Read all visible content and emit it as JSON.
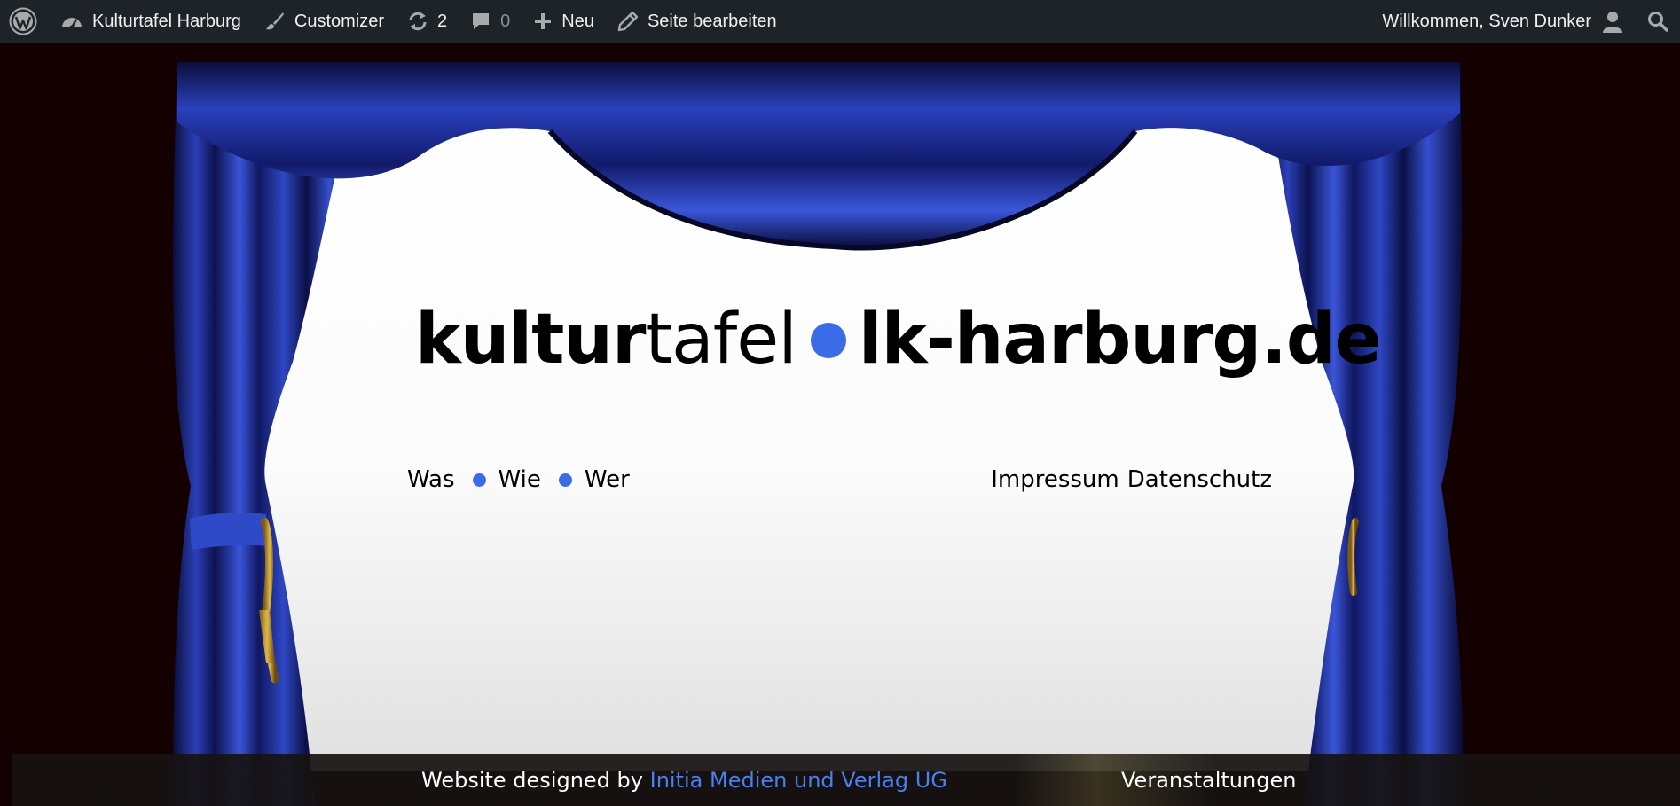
{
  "adminbar": {
    "wp_logo_icon": "wordpress-icon",
    "site_name": "Kulturtafel Harburg",
    "customizer": "Customizer",
    "updates_count": "2",
    "comments_count": "0",
    "new_label": "Neu",
    "edit_label": "Seite bearbeiten",
    "greeting": "Willkommen, Sven Dunker"
  },
  "site": {
    "title_bold": "kultur",
    "title_light": "tafel",
    "domain": "lk-harburg.de",
    "accent_color": "#3b6ce8"
  },
  "nav": {
    "left": [
      "Was",
      "Wie",
      "Wer"
    ],
    "right": [
      "Impressum",
      "Datenschutz"
    ]
  },
  "footer": {
    "credit_prefix": "Website designed by",
    "credit_link": "Initia Medien und Verlag UG",
    "events_link": "Veranstaltungen"
  }
}
